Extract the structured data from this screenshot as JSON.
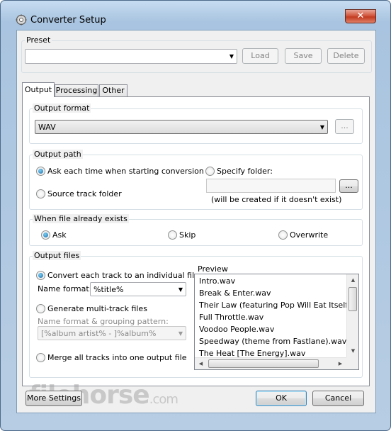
{
  "window": {
    "title": "Converter Setup",
    "close_glyph": "✕"
  },
  "preset": {
    "group_label": "Preset",
    "value": "",
    "load_label": "Load",
    "save_label": "Save",
    "delete_label": "Delete"
  },
  "tabs": [
    {
      "label": "Output",
      "active": true
    },
    {
      "label": "Processing",
      "active": false
    },
    {
      "label": "Other",
      "active": false
    }
  ],
  "output_format": {
    "group_label": "Output format",
    "value": "WAV",
    "options_button": "..."
  },
  "output_path": {
    "group_label": "Output path",
    "ask_label": "Ask each time when starting conversion",
    "ask_selected": true,
    "source_label": "Source track folder",
    "source_selected": false,
    "specify_label": "Specify folder:",
    "specify_selected": false,
    "folder_value": "",
    "browse_button": "...",
    "hint": "(will be created if it doesn't exist)"
  },
  "file_exists": {
    "group_label": "When file already exists",
    "options": [
      {
        "label": "Ask",
        "selected": true
      },
      {
        "label": "Skip",
        "selected": false
      },
      {
        "label": "Overwrite",
        "selected": false
      }
    ]
  },
  "output_files": {
    "group_label": "Output files",
    "convert_each_label": "Convert each track to an individual file",
    "convert_each_selected": true,
    "name_format_label": "Name format:",
    "name_format_value": "%title%",
    "multi_track_label": "Generate multi-track files",
    "multi_track_selected": false,
    "pattern_label": "Name format & grouping pattern:",
    "pattern_value": "[%album artist% - ]%album%",
    "merge_label": "Merge all tracks into one output file",
    "merge_selected": false,
    "preview_label": "Preview",
    "preview_items": [
      "Intro.wav",
      "Break & Enter.wav",
      "Their Law (featuring Pop Will Eat Itself).wav",
      "Full Throttle.wav",
      "Voodoo People.wav",
      "Speedway (theme from Fastlane).wav",
      "The Heat [The Energy].wav"
    ]
  },
  "footer": {
    "more_settings": "More Settings",
    "ok": "OK",
    "cancel": "Cancel"
  },
  "watermark": {
    "brand": "filehorse",
    "tld": ".com"
  }
}
